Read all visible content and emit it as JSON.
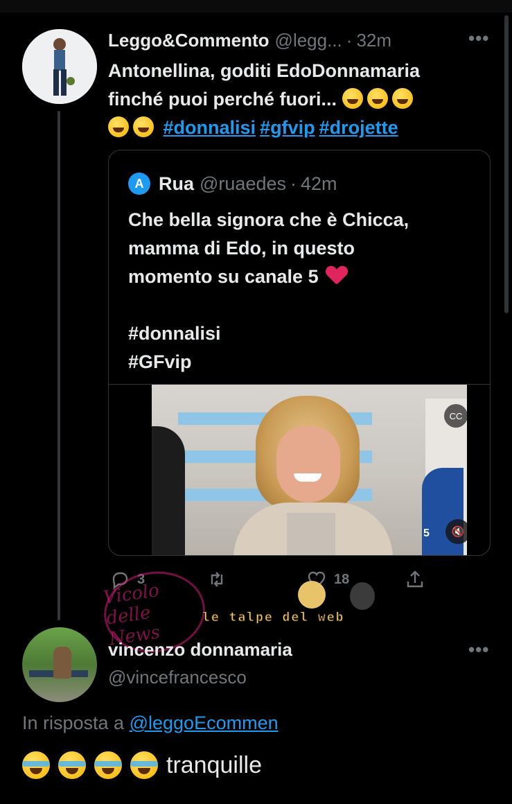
{
  "tweet": {
    "author_name": "Leggo&Commento",
    "author_handle": "@legg...",
    "separator": "·",
    "time": "32m",
    "text_line1": "Antonellina, goditi EdoDonnamaria",
    "text_line2": "finché puoi perché fuori...",
    "hashtags": [
      "#donnalisi",
      "#gfvip",
      "#drojette"
    ],
    "emoji_icon": "rolling-on-floor-laughing",
    "more_label": "•••",
    "stats": {
      "replies": "3",
      "likes": "18"
    }
  },
  "quote": {
    "avatar_letter": "A",
    "author_name": "Rua",
    "author_handle": "@ruaedes",
    "separator": "·",
    "time": "42m",
    "lines": [
      "Che bella signora che è Chicca,",
      "mamma di Edo, in questo",
      "momento su canale 5"
    ],
    "hashtags": [
      "#donnalisi",
      "#GFvip"
    ],
    "video": {
      "cc_label": "CC",
      "mute_label": "🔇",
      "logo": "5"
    }
  },
  "watermark": {
    "stamp_text": "Vicolo delle News",
    "banner_text": "le talpe del web"
  },
  "reply": {
    "author_name": "vincenzo donnamaria",
    "author_handle": "@vincefrancesco",
    "more_label": "•••",
    "reply_to_prefix": "In risposta a",
    "reply_to_handle": "@leggoEcommen",
    "body_text": "tranquille",
    "emoji_icon": "face-with-tears-of-joy"
  },
  "colors": {
    "background": "#000000",
    "text": "#e7e9ea",
    "secondary": "#71767b",
    "link": "#1d9bf0",
    "border": "#333639"
  }
}
